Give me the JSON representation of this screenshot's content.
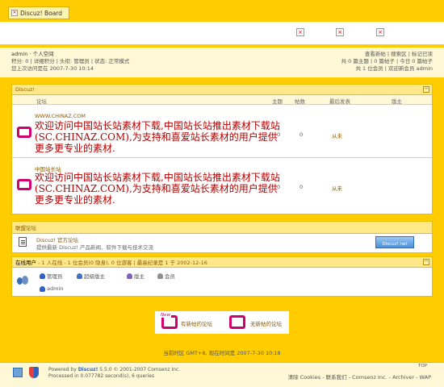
{
  "header": {
    "logo_text": "Discuz! Board",
    "logo_icon": "broken-image-icon",
    "nav_icons": [
      "broken-image-icon",
      "broken-image-icon",
      "broken-image-icon"
    ]
  },
  "user": {
    "name": "admin",
    "space": "· 个人空间",
    "line2": "积分: 0 | 详细积分 | 头衔: 管理员 | 状态: 正常模式",
    "line3": "您上次访问是在 2007-7-30 10:14",
    "right1": "查看新帖 | 搜索区 | 标记已读",
    "right2": "共 0 篇主题 | 0 篇帖子 | 今日 0 篇帖子",
    "right3": "共 1 位会员 | 欢迎新会员 admin"
  },
  "forum_block": {
    "title": "Discuz!",
    "collapse_icon": "minus-icon",
    "columns": {
      "forum": "论坛",
      "topics": "主题",
      "posts": "帖数",
      "lastpost": "最后发表",
      "moderator": "版主"
    },
    "forums": [
      {
        "name": "WWW.CHINAZ.COM",
        "desc": "欢迎访问中国站长站素材下载,中国站长站推出素材下载站(SC.CHINAZ.COM),为支持和喜爱站长素材的用户提供更多更专业的素材.",
        "topics": "0",
        "posts": "0",
        "lastpost": "从未",
        "moderator": ""
      },
      {
        "name": "中国站长站",
        "desc": "欢迎访问中国站长站素材下载,中国站长站推出素材下载站(SC.CHINAZ.COM),为支持和喜爱站长素材的用户提供更多更专业的素材.",
        "topics": "0",
        "posts": "0",
        "lastpost": "从未",
        "moderator": ""
      }
    ]
  },
  "union": {
    "title": "联盟论坛",
    "forum_name": "Discuz! 官方论坛",
    "forum_desc": "提供最新 Discuz! 产品新闻、软件下载与技术交流",
    "banner_text": "Discuz!.net"
  },
  "online": {
    "title": "在线用户",
    "stats": "- 1 人在线 - 1 位会员(0 隐身), 0 位游客 | 最高纪录是 1 于 2002-12-16",
    "legend": [
      "管理员",
      "超级版主",
      "版主",
      "会员"
    ],
    "users": [
      "admin"
    ],
    "legend_colors": [
      "#3060C0",
      "#4070C0",
      "#8060C0",
      "#909090"
    ]
  },
  "bottom_legend": {
    "new_tag": "New",
    "new_label": "有新帖的论坛",
    "none_label": "无新帖的论坛"
  },
  "timeline": "当前时区 GMT+8, 现在时间是 2007-7-30 10:18",
  "footer": {
    "powered": "Powered by",
    "brand": "Discuz!",
    "version": "5.5.0",
    "copyright": "© 2001-2007 Comsenz Inc.",
    "processed": "Processed in 0.077782 second(s), 6 queries",
    "links": "清除 Cookies - 联系我们 - Comsenz Inc. - Archiver - WAP",
    "top": "TOP"
  },
  "colors": {
    "accent": "#FFCC00",
    "forum_icon": "#D0006F",
    "desc_text": "#B00000"
  }
}
